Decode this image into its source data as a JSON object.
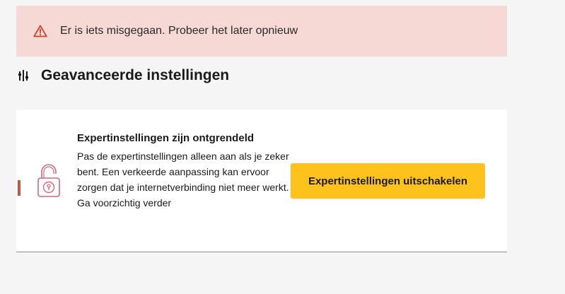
{
  "error_banner": {
    "icon": "warning-triangle-icon",
    "message": "Er is iets misgegaan. Probeer het later opnieuw",
    "background": "#f6d9d4",
    "icon_color": "#c8442f"
  },
  "section": {
    "icon": "settings-slider-icon",
    "title": "Geavanceerde instellingen"
  },
  "expert_card": {
    "icon": "unlocked-padlock-icon",
    "heading": "Expertinstellingen zijn ontgrendeld",
    "body": "Pas de expertinstellingen alleen aan als je zeker bent. Een verkeerde aanpassing kan ervoor zorgen dat je internetverbinding niet meer werkt.",
    "caution": "Ga voorzichtig verder",
    "button_label": "Expertinstellingen uitschakelen",
    "button_color": "#fdc21b",
    "accent_color": "#c8553d"
  }
}
